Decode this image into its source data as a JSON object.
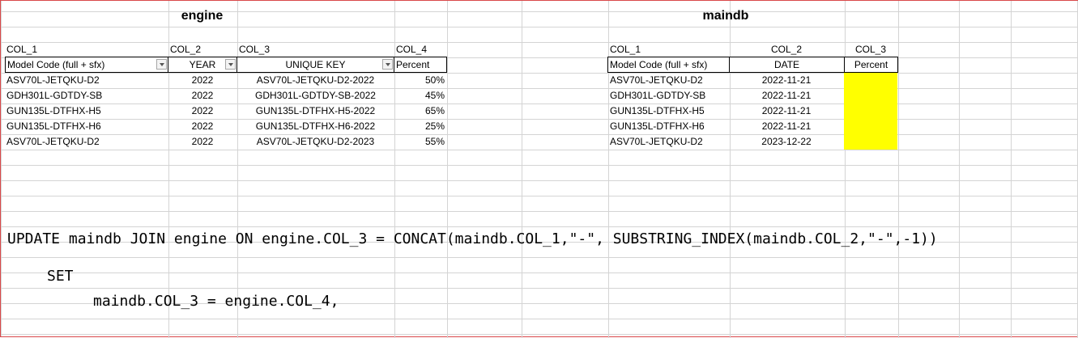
{
  "engine": {
    "title": "engine",
    "col_labels": [
      "COL_1",
      "COL_2",
      "COL_3",
      "COL_4"
    ],
    "headers": [
      "Model Code (full + sfx)",
      "YEAR",
      "UNIQUE KEY",
      "Percent"
    ],
    "rows": [
      [
        "ASV70L-JETQKU-D2",
        "2022",
        "ASV70L-JETQKU-D2-2022",
        "50%"
      ],
      [
        "GDH301L-GDTDY-SB",
        "2022",
        "GDH301L-GDTDY-SB-2022",
        "45%"
      ],
      [
        "GUN135L-DTFHX-H5",
        "2022",
        "GUN135L-DTFHX-H5-2022",
        "65%"
      ],
      [
        "GUN135L-DTFHX-H6",
        "2022",
        "GUN135L-DTFHX-H6-2022",
        "25%"
      ],
      [
        "ASV70L-JETQKU-D2",
        "2022",
        "ASV70L-JETQKU-D2-2023",
        "55%"
      ]
    ]
  },
  "maindb": {
    "title": "maindb",
    "col_labels": [
      "COL_1",
      "COL_2",
      "COL_3"
    ],
    "headers": [
      "Model Code (full + sfx)",
      "DATE",
      "Percent"
    ],
    "rows": [
      [
        "ASV70L-JETQKU-D2",
        "2022-11-21",
        ""
      ],
      [
        "GDH301L-GDTDY-SB",
        "2022-11-21",
        ""
      ],
      [
        "GUN135L-DTFHX-H5",
        "2022-11-21",
        ""
      ],
      [
        "GUN135L-DTFHX-H6",
        "2022-11-21",
        ""
      ],
      [
        "ASV70L-JETQKU-D2",
        "2023-12-22",
        ""
      ]
    ],
    "highlight_color": "#ffff00"
  },
  "sql": {
    "line1": "UPDATE maindb JOIN engine ON engine.COL_3 = CONCAT(maindb.COL_1,\"-\", SUBSTRING_INDEX(maindb.COL_2,\"-\",-1))",
    "line2": "SET",
    "line3": "maindb.COL_3 = engine.COL_4,"
  }
}
